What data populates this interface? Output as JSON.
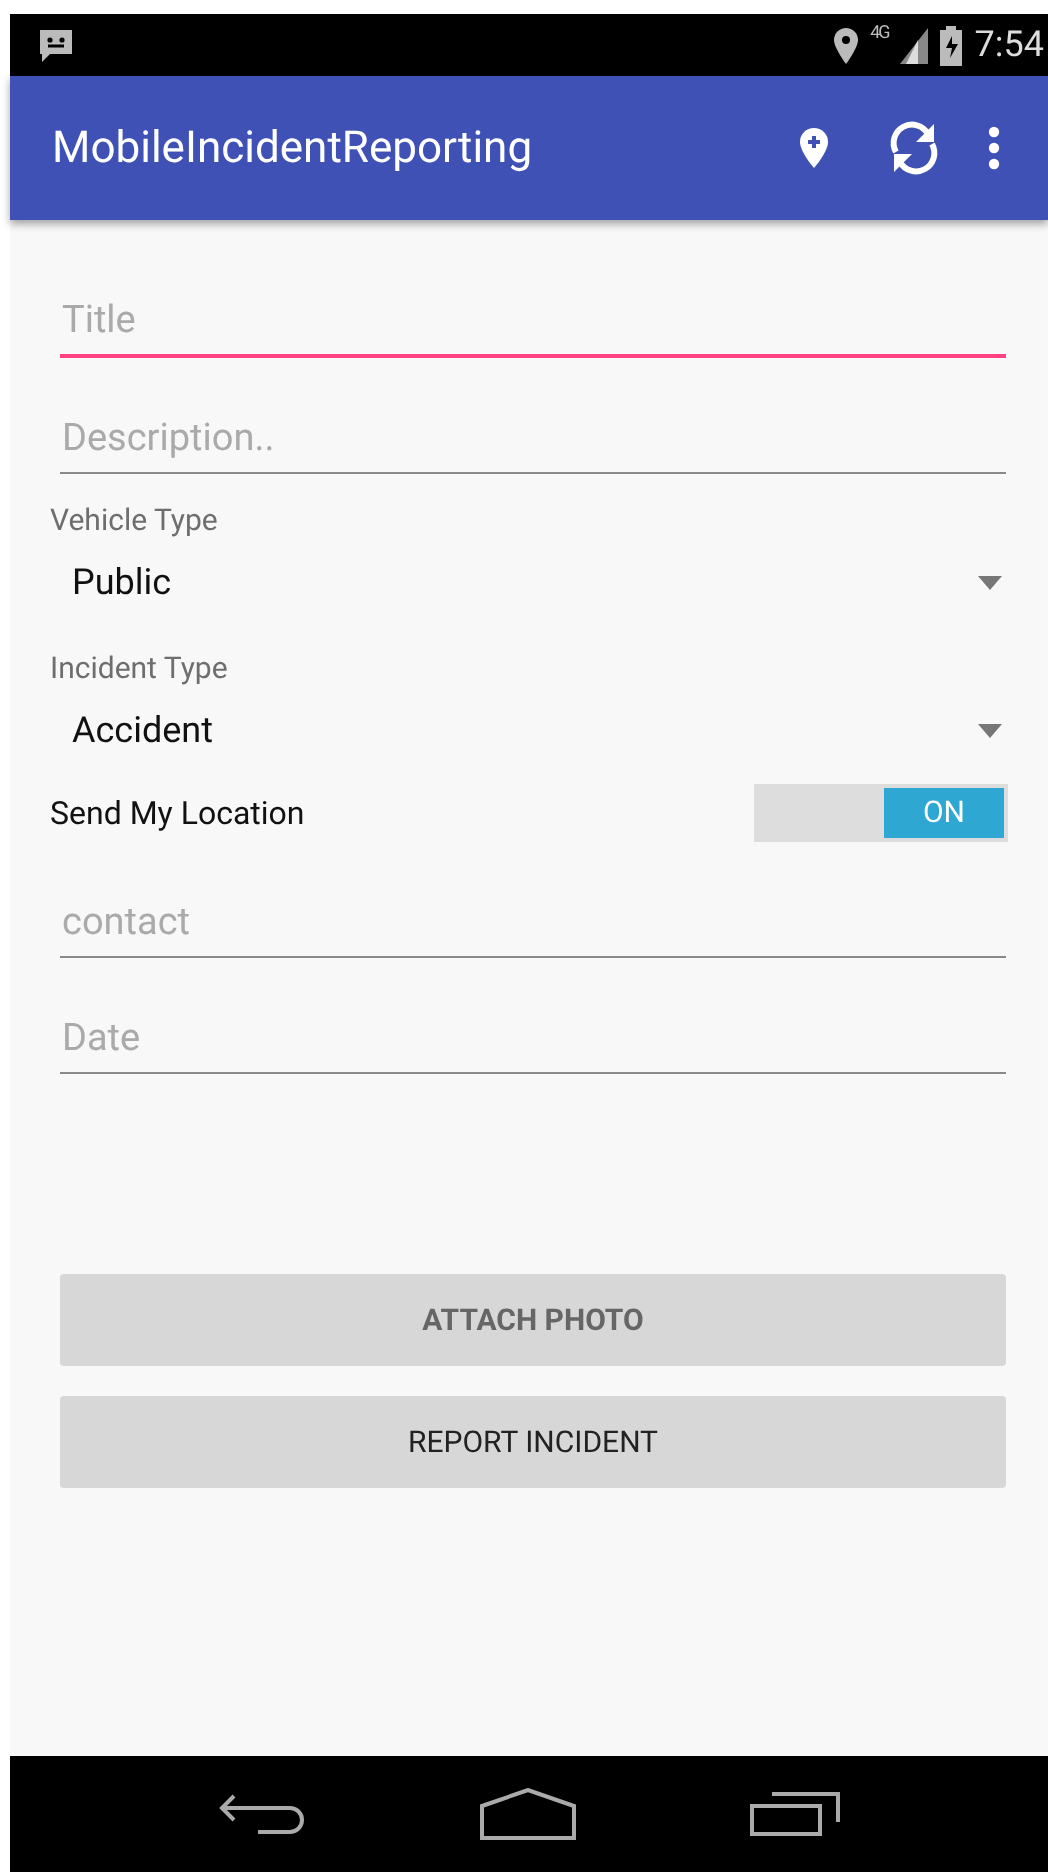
{
  "status_bar": {
    "network": "4G",
    "time": "7:54"
  },
  "app_bar": {
    "title": "MobileIncidentReporting"
  },
  "fields_top": [
    {
      "placeholder": "Title",
      "focused": true
    },
    {
      "placeholder": "Description..",
      "focused": false
    }
  ],
  "spinners": [
    {
      "label": "Vehicle Type",
      "value": "Public"
    },
    {
      "label": "Incident Type",
      "value": "Accident"
    }
  ],
  "location_switch": {
    "label": "Send My Location",
    "on": true,
    "state_text": "ON"
  },
  "fields_bottom": [
    {
      "placeholder": "contact",
      "focused": false
    },
    {
      "placeholder": "Date",
      "focused": false
    }
  ],
  "buttons": [
    {
      "label": "ATTACH PHOTO",
      "kind": "bold"
    },
    {
      "label": "REPORT INCIDENT",
      "kind": "plain"
    }
  ]
}
